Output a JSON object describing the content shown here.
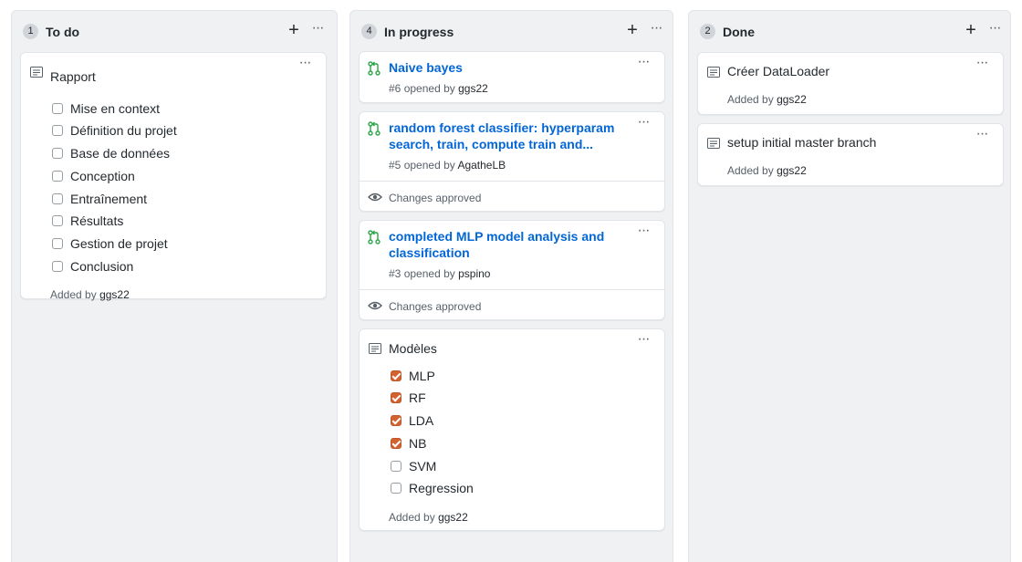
{
  "columns": [
    {
      "count": "1",
      "title": "To do",
      "cards": [
        {
          "type": "note",
          "title": "Rapport",
          "tasks": [
            {
              "label": "Mise en context",
              "checked": false
            },
            {
              "label": "Définition du projet",
              "checked": false
            },
            {
              "label": "Base de données",
              "checked": false
            },
            {
              "label": "Conception",
              "checked": false
            },
            {
              "label": "Entraînement",
              "checked": false
            },
            {
              "label": "Résultats",
              "checked": false
            },
            {
              "label": "Gestion de projet",
              "checked": false
            },
            {
              "label": "Conclusion",
              "checked": false
            }
          ],
          "added_prefix": "Added by",
          "added_user": "ggs22"
        }
      ]
    },
    {
      "count": "4",
      "title": "In progress",
      "cards": [
        {
          "type": "pr",
          "title": "Naive bayes",
          "number": "#6",
          "opened_text": "opened by",
          "user": "ggs22"
        },
        {
          "type": "pr",
          "title_line1": "random forest classifier: hyperparam",
          "title_line2": "search, train, compute train and...",
          "number": "#5",
          "opened_text": "opened by",
          "user": "AgatheLB",
          "status": "Changes approved"
        },
        {
          "type": "pr",
          "title_line1": "completed MLP model analysis and",
          "title_line2": "classification",
          "number": "#3",
          "opened_text": "opened by",
          "user": "pspino",
          "status": "Changes approved"
        },
        {
          "type": "note",
          "title": "Modèles",
          "tasks": [
            {
              "label": "MLP",
              "checked": true
            },
            {
              "label": "RF",
              "checked": true
            },
            {
              "label": "LDA",
              "checked": true
            },
            {
              "label": "NB",
              "checked": true
            },
            {
              "label": "SVM",
              "checked": false
            },
            {
              "label": "Regression",
              "checked": false
            }
          ],
          "added_prefix": "Added by",
          "added_user": "ggs22"
        }
      ]
    },
    {
      "count": "2",
      "title": "Done",
      "cards": [
        {
          "type": "note",
          "title": "Créer DataLoader",
          "added_prefix": "Added by",
          "added_user": "ggs22"
        },
        {
          "type": "note",
          "title": "setup initial master branch",
          "added_prefix": "Added by",
          "added_user": "ggs22"
        }
      ]
    }
  ],
  "icons": {
    "add": "plus-icon",
    "more": "kebab-horizontal-icon",
    "note": "note-icon",
    "pull_request": "git-pull-request-icon",
    "approved": "eye-icon"
  },
  "colors": {
    "column_bg": "#eff1f3",
    "link": "#0366d6",
    "pr_open": "#28a745",
    "checkbox_checked": "#d1632f"
  }
}
